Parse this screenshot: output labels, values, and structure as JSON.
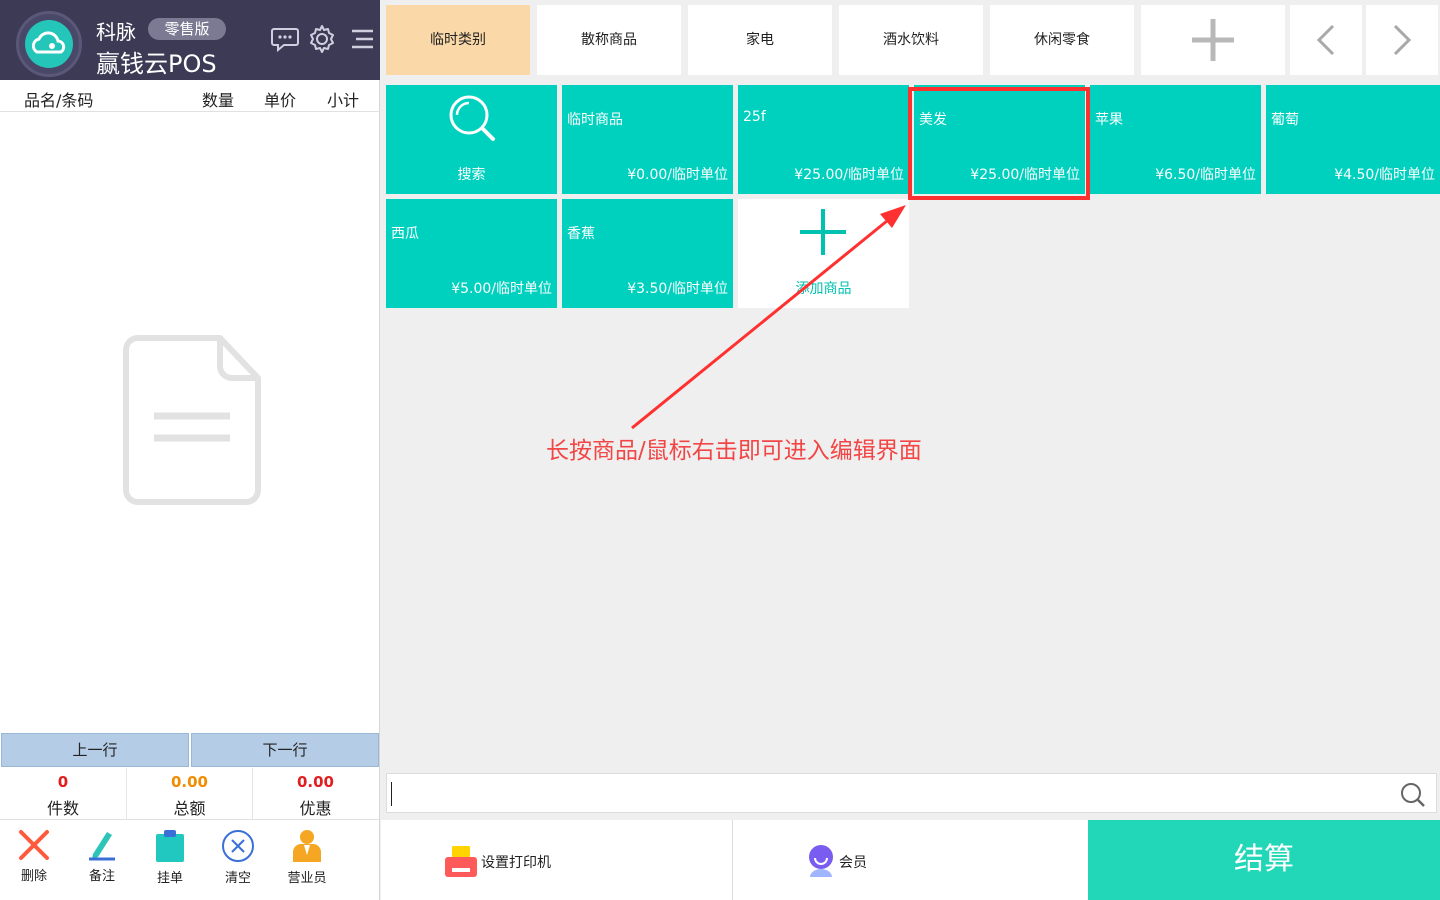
{
  "header": {
    "brand": "科脉",
    "edition": "零售版",
    "product": "赢钱云POS",
    "icons": [
      "chat-icon",
      "gear-icon",
      "menu-icon"
    ]
  },
  "cart": {
    "columns": {
      "name": "品名/条码",
      "qty": "数量",
      "price": "单价",
      "subtotal": "小计"
    },
    "prev_row": "上一行",
    "next_row": "下一行",
    "stats": [
      {
        "value": "0",
        "label": "件数",
        "color": "#e02020"
      },
      {
        "value": "0.00",
        "label": "总额",
        "color": "#f08c00"
      },
      {
        "value": "0.00",
        "label": "优惠",
        "color": "#e02020"
      }
    ]
  },
  "toolbar": {
    "delete": "删除",
    "note": "备注",
    "hold": "挂单",
    "clear": "清空",
    "salesperson": "营业员"
  },
  "categories": {
    "items": [
      "临时类别",
      "散称商品",
      "家电",
      "酒水饮料",
      "休闲零食"
    ],
    "active": "临时类别"
  },
  "products": {
    "search_label": "搜索",
    "add_label": "添加商品",
    "items": [
      {
        "name": "临时商品",
        "price": "¥0.00/临时单位"
      },
      {
        "name": "25f",
        "price": "¥25.00/临时单位"
      },
      {
        "name": "美发",
        "price": "¥25.00/临时单位"
      },
      {
        "name": "苹果",
        "price": "¥6.50/临时单位"
      },
      {
        "name": "葡萄",
        "price": "¥4.50/临时单位"
      },
      {
        "name": "西瓜",
        "price": "¥5.00/临时单位"
      },
      {
        "name": "香蕉",
        "price": "¥3.50/临时单位"
      }
    ]
  },
  "annotation": "长按商品/鼠标右击即可进入编辑界面",
  "search": {
    "value": "",
    "placeholder": ""
  },
  "bottom": {
    "printer": "设置打印机",
    "member": "会员",
    "checkout": "结算"
  },
  "colors": {
    "tile": "#00d1bf",
    "active_category": "#fbd8a8",
    "checkout": "#22d6b8",
    "header": "#3c3a55",
    "annotation": "#f24646"
  }
}
